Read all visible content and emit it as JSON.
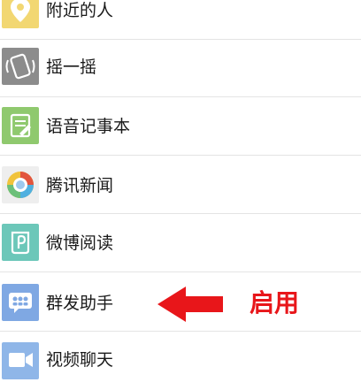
{
  "menu": {
    "items": [
      {
        "label": "附近的人",
        "icon": "location-pin-icon"
      },
      {
        "label": "摇一摇",
        "icon": "shake-phone-icon"
      },
      {
        "label": "语音记事本",
        "icon": "voice-notepad-icon"
      },
      {
        "label": "腾讯新闻",
        "icon": "tencent-news-icon"
      },
      {
        "label": "微博阅读",
        "icon": "weibo-reading-icon"
      },
      {
        "label": "群发助手",
        "icon": "group-message-icon"
      },
      {
        "label": "视频聊天",
        "icon": "video-chat-icon"
      }
    ]
  },
  "annotation": {
    "text": "启用",
    "color": "#e8161a"
  },
  "colors": {
    "location_icon_bg": "#f2d772",
    "shake_icon_bg": "#8c8c8c",
    "notepad_icon_bg": "#8fc96e",
    "weibo_icon_bg": "#6cc7b9",
    "group_icon_bg": "#7fa8e3",
    "video_icon_bg": "#8fb6e8"
  }
}
